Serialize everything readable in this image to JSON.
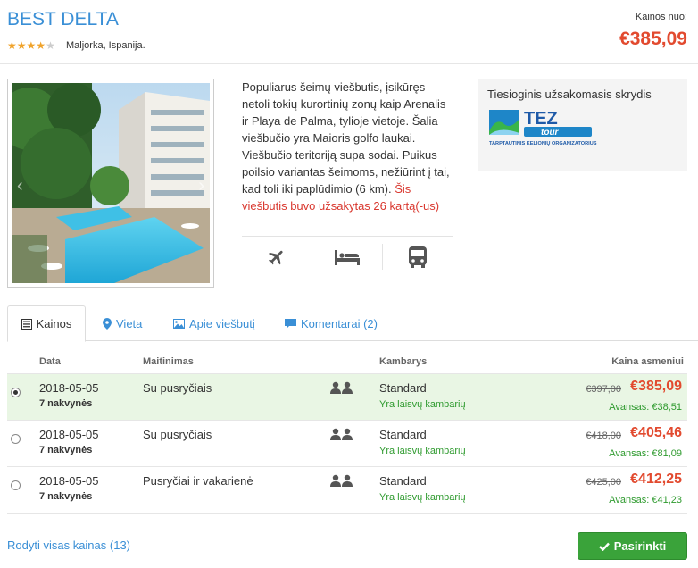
{
  "hotel": {
    "name": "BEST DELTA",
    "rating": 4,
    "rating_max": 5,
    "location": "Maljorka, Ispanija."
  },
  "price": {
    "label": "Kainos nuo:",
    "value": "€385,09"
  },
  "description": {
    "text": "Populiarus šeimų viešbutis, įsikūręs netoli tokių kurortinių zonų kaip Arenalis ir Playa de Palma, tylioje vietoje. Šalia viešbučio yra Maioris golfo laukai. Viešbučio teritoriją supa sodai. Puikus poilsio variantas šeimoms, nežiūrint į tai, kad toli iki paplūdimio (6 km).",
    "booked": "Šis viešbutis buvo užsakytas 26 kartą(-us)"
  },
  "amenities": [
    "plane-icon",
    "bed-icon",
    "bus-icon"
  ],
  "flight_box": {
    "title": "Tiesioginis užsakomasis skrydis",
    "logo_text": "TEZ tour",
    "logo_subtitle": "TARPTAUTINIS KELIONIŲ ORGANIZATORIUS"
  },
  "tabs": [
    {
      "label": "Kainos",
      "icon": "list-icon"
    },
    {
      "label": "Vieta",
      "icon": "map-marker-icon"
    },
    {
      "label": "Apie viešbutį",
      "icon": "image-icon"
    },
    {
      "label": "Komentarai (2)",
      "icon": "comment-icon"
    }
  ],
  "table": {
    "headers": {
      "date": "Data",
      "meal": "Maitinimas",
      "room": "Kambarys",
      "price": "Kaina asmeniui"
    },
    "rows": [
      {
        "selected": true,
        "date": "2018-05-05",
        "nights": "7 nakvynės",
        "meal": "Su pusryčiais",
        "room": "Standard",
        "availability": "Yra laisvų kambarių",
        "old_price": "€397,00",
        "price": "€385,09",
        "deposit": "Avansas: €38,51"
      },
      {
        "selected": false,
        "date": "2018-05-05",
        "nights": "7 nakvynės",
        "meal": "Su pusryčiais",
        "room": "Standard",
        "availability": "Yra laisvų kambarių",
        "old_price": "€418,00",
        "price": "€405,46",
        "deposit": "Avansas: €81,09"
      },
      {
        "selected": false,
        "date": "2018-05-05",
        "nights": "7 nakvynės",
        "meal": "Pusryčiai ir vakarienė",
        "room": "Standard",
        "availability": "Yra laisvų kambarių",
        "old_price": "€425,00",
        "price": "€412,25",
        "deposit": "Avansas: €41,23"
      }
    ]
  },
  "footer": {
    "show_all": "Rodyti visas kainas (13)",
    "select_button": "Pasirinkti"
  },
  "colors": {
    "accent": "#3a8fd6",
    "price": "#e24a2f",
    "green": "#3aa33a",
    "star": "#f0a32b"
  }
}
